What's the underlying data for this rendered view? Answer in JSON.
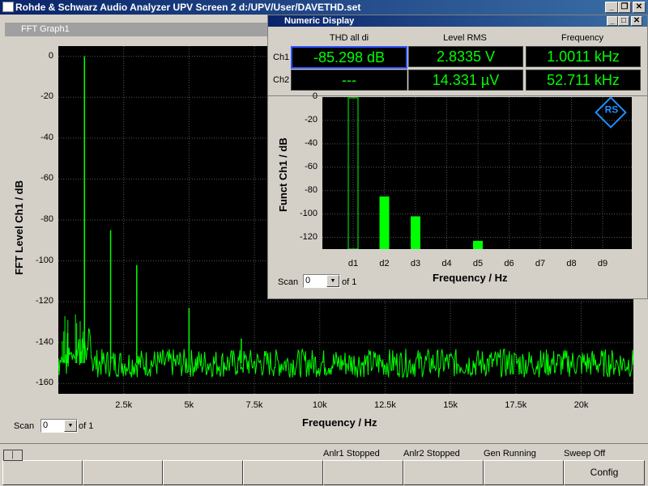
{
  "window": {
    "title": "Rohde & Schwarz Audio Analyzer UPV Screen 2  d:/UPV/User/DAVETHD.set",
    "minimize": "_",
    "maximize": "❐",
    "close": "✕"
  },
  "fft_window": {
    "title": "FFT Graph1",
    "ylabel": "FFT Level Ch1 / dB",
    "xlabel": "Frequency / Hz",
    "scan_label": "Scan",
    "scan_value": "0",
    "scan_of": "of 1"
  },
  "numeric_display": {
    "title": "Numeric Display",
    "columns": [
      "THD all di",
      "Level RMS",
      "Frequency"
    ],
    "rows": [
      {
        "label": "Ch1",
        "values": [
          "-85.298 dB",
          "2.8335 V",
          "1.0011 kHz"
        ]
      },
      {
        "label": "Ch2",
        "values": [
          "---",
          "14.331 µV",
          "52.711 kHz"
        ]
      }
    ]
  },
  "harmonics_window": {
    "ylabel": "Funct Ch1 / dB",
    "xlabel": "Frequency / Hz",
    "scan_label": "Scan",
    "scan_value": "0",
    "scan_of": "of 1"
  },
  "chart_data": [
    {
      "type": "line",
      "xlabel": "Frequency / Hz",
      "ylabel": "FFT Level Ch1 / dB",
      "xlim": [
        0,
        22000
      ],
      "ylim": [
        -165,
        5
      ],
      "xticks": [
        2500,
        5000,
        7500,
        10000,
        12500,
        15000,
        17500,
        20000
      ],
      "xtick_labels": [
        "2.5k",
        "5k",
        "7.5k",
        "10k",
        "12.5k",
        "15k",
        "17.5k",
        "20k"
      ],
      "yticks": [
        0,
        -20,
        -40,
        -60,
        -80,
        -100,
        -120,
        -140,
        -160
      ],
      "grid": true,
      "color": "#00ff00",
      "noise_floor": -150,
      "peaks": [
        {
          "x": 1000,
          "y": 0
        },
        {
          "x": 1000,
          "y": -74
        },
        {
          "x": 2000,
          "y": -85
        },
        {
          "x": 3000,
          "y": -102
        },
        {
          "x": 5000,
          "y": -123
        },
        {
          "x": 7000,
          "y": -138
        }
      ]
    },
    {
      "type": "bar",
      "xlabel": "Frequency / Hz",
      "ylabel": "Funct Ch1 / dB",
      "categories": [
        "d1",
        "d2",
        "d3",
        "d4",
        "d5",
        "d6",
        "d7",
        "d8",
        "d9"
      ],
      "values": [
        0,
        -85,
        -102,
        -130,
        -123,
        -130,
        -130,
        -130,
        -130
      ],
      "ylim": [
        -130,
        0
      ],
      "yticks": [
        0,
        -20,
        -40,
        -60,
        -80,
        -100,
        -120
      ],
      "grid": true,
      "color": "#00ff00"
    }
  ],
  "status": {
    "anlr1": "Anlr1 Stopped",
    "anlr2": "Anlr2 Stopped",
    "gen": "Gen Running",
    "sweep": "Sweep Off",
    "config": "Config"
  },
  "logo": {
    "text": "RS",
    "color": "#1e90ff"
  }
}
